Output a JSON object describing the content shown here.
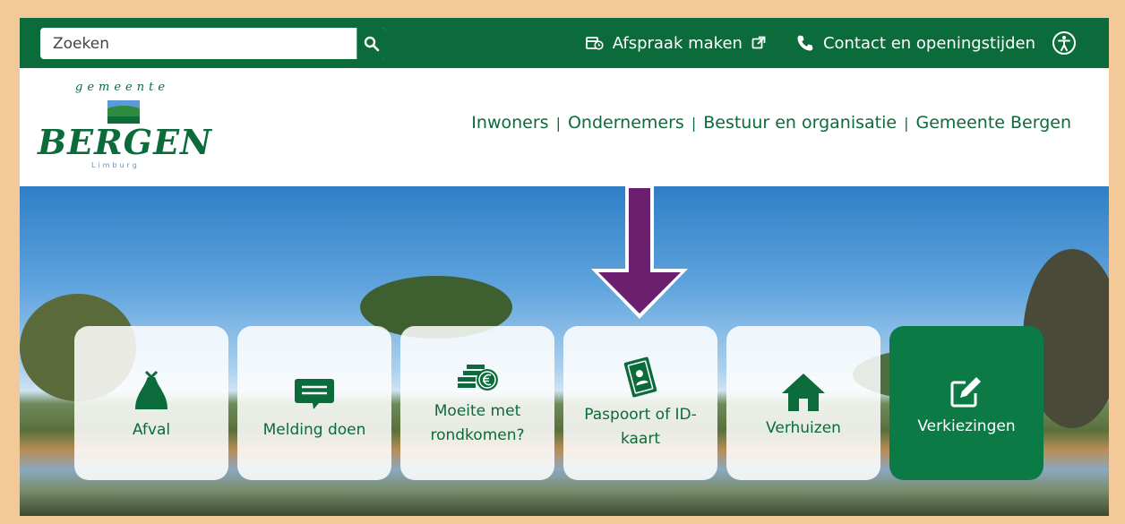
{
  "search": {
    "placeholder": "Zoeken",
    "icon": "search-icon"
  },
  "toplinks": {
    "appointment": {
      "label": "Afspraak maken",
      "icon": "calendar-clock-icon",
      "ext_icon": "external-link-icon"
    },
    "contact": {
      "label": "Contact en openingstijden",
      "icon": "phone-icon"
    },
    "accessibility_icon": "accessibility-icon"
  },
  "logo": {
    "top": "gemeente",
    "main": "BERGEN",
    "sub": "Limburg"
  },
  "nav": {
    "items": [
      "Inwoners",
      "Ondernemers",
      "Bestuur en organisatie",
      "Gemeente Bergen"
    ],
    "separator": "|"
  },
  "tiles": [
    {
      "label": "Afval",
      "icon": "garbage-bag-icon"
    },
    {
      "label": "Melding doen",
      "icon": "chat-message-icon"
    },
    {
      "label": "Moeite met rondkomen?",
      "icon": "coins-euro-icon"
    },
    {
      "label": "Paspoort of ID-kaart",
      "icon": "id-passport-icon"
    },
    {
      "label": "Verhuizen",
      "icon": "house-icon"
    },
    {
      "label": "Verkiezingen",
      "icon": "edit-ballot-icon"
    }
  ],
  "colors": {
    "brand_green": "#0b6b3a",
    "accent_purple": "#6b1f6e",
    "frame_bg": "#f3c99a"
  }
}
